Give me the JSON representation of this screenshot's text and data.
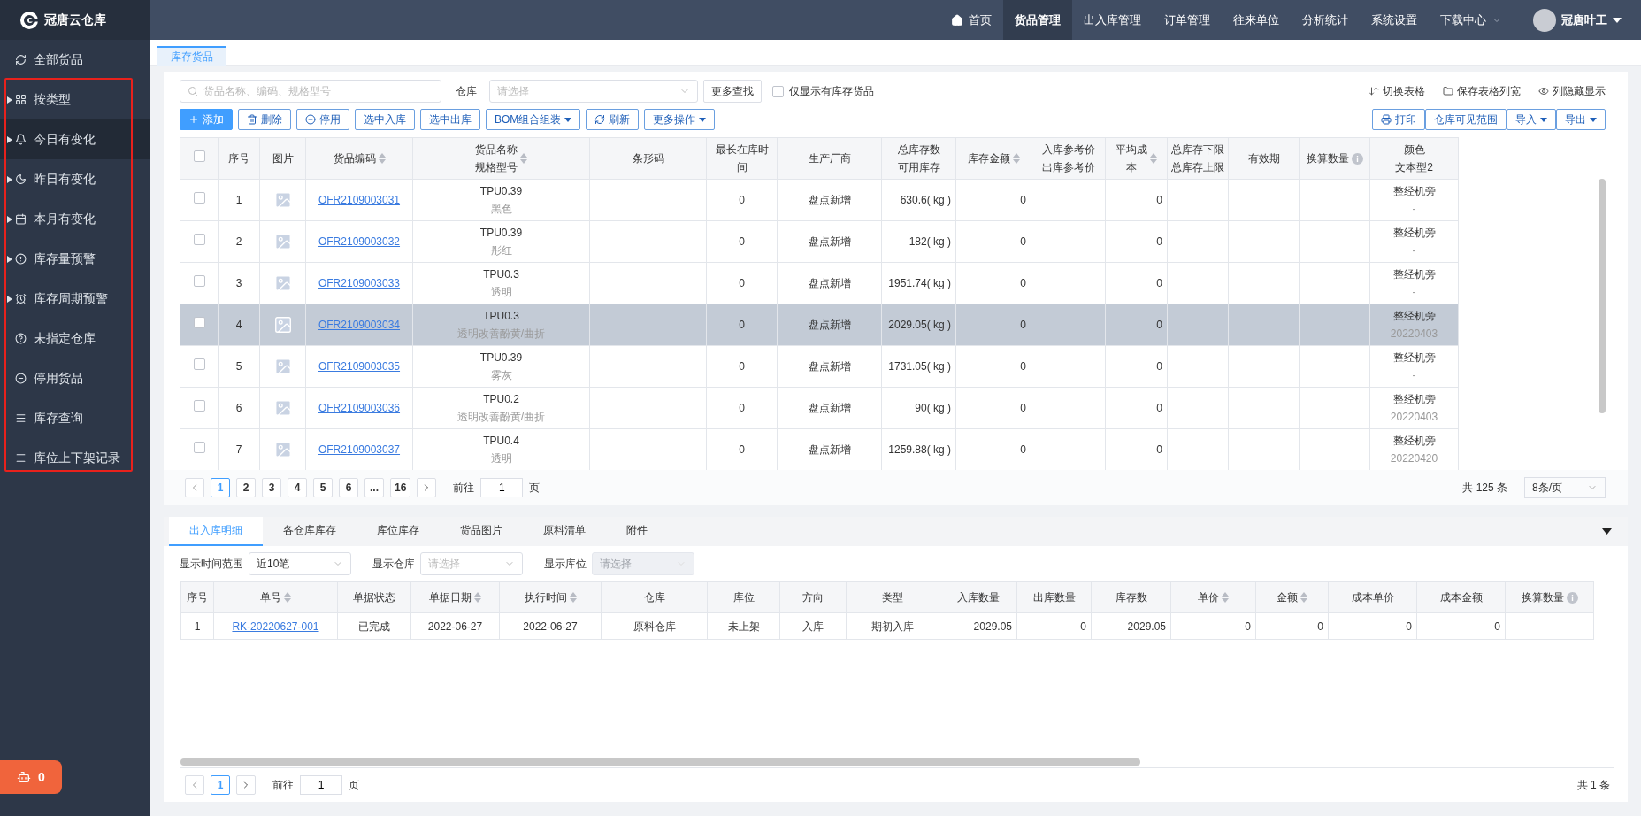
{
  "app": {
    "logo_text": "冠唐云仓库",
    "nav": [
      {
        "label": "首页",
        "kind": "home",
        "selected": false
      },
      {
        "label": "货品管理",
        "kind": "plain",
        "selected": true
      },
      {
        "label": "出入库管理",
        "kind": "plain",
        "selected": false
      },
      {
        "label": "订单管理",
        "kind": "plain",
        "selected": false
      },
      {
        "label": "往来单位",
        "kind": "plain",
        "selected": false
      },
      {
        "label": "分析统计",
        "kind": "plain",
        "selected": false
      },
      {
        "label": "系统设置",
        "kind": "plain",
        "selected": false
      },
      {
        "label": "下载中心",
        "kind": "dropdown",
        "selected": false
      }
    ],
    "user": {
      "name": "冠唐叶工"
    }
  },
  "sidebar": {
    "items": [
      {
        "label": "全部货品",
        "expandable": false,
        "selected": false
      },
      {
        "label": "按类型",
        "expandable": true,
        "selected": false
      },
      {
        "label": "今日有变化",
        "expandable": true,
        "selected": true
      },
      {
        "label": "昨日有变化",
        "expandable": true,
        "selected": false
      },
      {
        "label": "本月有变化",
        "expandable": true,
        "selected": false
      },
      {
        "label": "库存量预警",
        "expandable": true,
        "selected": false
      },
      {
        "label": "库存周期预警",
        "expandable": true,
        "selected": false
      },
      {
        "label": "未指定仓库",
        "expandable": false,
        "selected": false
      },
      {
        "label": "停用货品",
        "expandable": false,
        "selected": false
      },
      {
        "label": "库存查询",
        "expandable": false,
        "selected": false
      },
      {
        "label": "库位上下架记录",
        "expandable": false,
        "selected": false
      }
    ],
    "badge": {
      "count": "0"
    }
  },
  "page_tabs": [
    {
      "label": "库存货品",
      "selected": true
    }
  ],
  "filters": {
    "search": {
      "placeholder": "货品名称、编码、规格型号"
    },
    "warehouse": {
      "label": "仓库",
      "placeholder": "请选择"
    },
    "more_search": "更多查找",
    "only_stock": {
      "label": "仅显示有库存货品",
      "checked": false
    }
  },
  "view_links": [
    "切换表格",
    "保存表格列宽",
    "列隐藏显示"
  ],
  "actions": [
    {
      "label": "添加",
      "kind": "primary"
    },
    {
      "label": "删除",
      "kind": "plain"
    },
    {
      "label": "停用",
      "kind": "plain"
    },
    {
      "label": "选中入库",
      "kind": "plain"
    },
    {
      "label": "选中出库",
      "kind": "plain"
    },
    {
      "label": "BOM组合组装",
      "kind": "dropdown"
    },
    {
      "label": "刷新",
      "kind": "plain"
    },
    {
      "label": "更多操作",
      "kind": "dropdown"
    }
  ],
  "right_actions": [
    {
      "label": "打印",
      "kind": "plain"
    },
    {
      "label": "仓库可见范围",
      "kind": "plain"
    },
    {
      "label": "导入",
      "kind": "dropdown"
    },
    {
      "label": "导出",
      "kind": "dropdown"
    }
  ],
  "table": {
    "header_checkbox": {
      "checked": false
    },
    "columns": [
      {
        "lines": [
          "序号"
        ],
        "sortable": false,
        "info": false
      },
      {
        "lines": [
          "图片"
        ],
        "sortable": false,
        "info": false
      },
      {
        "lines": [
          "货品编码"
        ],
        "sortable": true,
        "info": false
      },
      {
        "lines": [
          "货品名称",
          "规格型号"
        ],
        "sortable": true,
        "info": false
      },
      {
        "lines": [
          "条形码"
        ],
        "sortable": false,
        "info": false
      },
      {
        "lines": [
          "最长在库时间"
        ],
        "sortable": false,
        "info": false
      },
      {
        "lines": [
          "生产厂商"
        ],
        "sortable": false,
        "info": false
      },
      {
        "lines": [
          "总库存数",
          "可用库存"
        ],
        "sortable": false,
        "info": false
      },
      {
        "lines": [
          "库存金额"
        ],
        "sortable": true,
        "info": false
      },
      {
        "lines": [
          "入库参考价",
          "出库参考价"
        ],
        "sortable": false,
        "info": false
      },
      {
        "lines": [
          "平均成",
          "本"
        ],
        "sortable": true,
        "info": false
      },
      {
        "lines": [
          "总库存下限",
          "总库存上限"
        ],
        "sortable": false,
        "info": false
      },
      {
        "lines": [
          "有效期"
        ],
        "sortable": false,
        "info": false
      },
      {
        "lines": [
          "换算数量"
        ],
        "sortable": false,
        "info": true
      },
      {
        "lines": [
          "颜色",
          "文本型2"
        ],
        "sortable": false,
        "info": false
      }
    ],
    "rows": [
      {
        "checked": false,
        "selected": false,
        "index": "1",
        "code": "OFR2109003031",
        "name": "TPU0.39",
        "spec": "黑色",
        "stock_time": "0",
        "maker": "盘点新增",
        "stock": "630.6( kg )",
        "amount": "0",
        "avg_cost": "0",
        "color_value": "整经机旁",
        "text2": "-"
      },
      {
        "checked": false,
        "selected": false,
        "index": "2",
        "code": "OFR2109003032",
        "name": "TPU0.39",
        "spec": "彤红",
        "stock_time": "0",
        "maker": "盘点新增",
        "stock": "182( kg )",
        "amount": "0",
        "avg_cost": "0",
        "color_value": "整经机旁",
        "text2": "-"
      },
      {
        "checked": false,
        "selected": false,
        "index": "3",
        "code": "OFR2109003033",
        "name": "TPU0.3",
        "spec": "透明",
        "stock_time": "0",
        "maker": "盘点新增",
        "stock": "1951.74( kg )",
        "amount": "0",
        "avg_cost": "0",
        "color_value": "整经机旁",
        "text2": "-"
      },
      {
        "checked": false,
        "selected": true,
        "index": "4",
        "code": "OFR2109003034",
        "name": "TPU0.3",
        "spec": "透明改善酚黄/曲折",
        "stock_time": "0",
        "maker": "盘点新增",
        "stock": "2029.05( kg )",
        "amount": "0",
        "avg_cost": "0",
        "color_value": "整经机旁",
        "text2": "20220403"
      },
      {
        "checked": false,
        "selected": false,
        "index": "5",
        "code": "OFR2109003035",
        "name": "TPU0.39",
        "spec": "雾灰",
        "stock_time": "0",
        "maker": "盘点新增",
        "stock": "1731.05( kg )",
        "amount": "0",
        "avg_cost": "0",
        "color_value": "整经机旁",
        "text2": "-"
      },
      {
        "checked": false,
        "selected": false,
        "index": "6",
        "code": "OFR2109003036",
        "name": "TPU0.2",
        "spec": "透明改善酚黄/曲折",
        "stock_time": "0",
        "maker": "盘点新增",
        "stock": "90( kg )",
        "amount": "0",
        "avg_cost": "0",
        "color_value": "整经机旁",
        "text2": "20220403"
      },
      {
        "checked": false,
        "selected": false,
        "index": "7",
        "code": "OFR2109003037",
        "name": "TPU0.4",
        "spec": "透明",
        "stock_time": "0",
        "maker": "盘点新增",
        "stock": "1259.88( kg )",
        "amount": "0",
        "avg_cost": "0",
        "color_value": "整经机旁",
        "text2": "20220420"
      }
    ]
  },
  "pagination": {
    "pages": [
      {
        "label": "1",
        "selected": true
      },
      {
        "label": "2",
        "selected": false
      },
      {
        "label": "3",
        "selected": false
      },
      {
        "label": "4",
        "selected": false
      },
      {
        "label": "5",
        "selected": false
      },
      {
        "label": "6",
        "selected": false
      },
      {
        "label": "...",
        "selected": false
      },
      {
        "label": "16",
        "selected": false
      }
    ],
    "goto_label": "前往",
    "goto_value": "1",
    "goto_suffix": "页",
    "total": "共 125 条",
    "page_size": "8条/页"
  },
  "detail": {
    "tabs": [
      {
        "label": "出入库明细",
        "selected": true
      },
      {
        "label": "各仓库库存",
        "selected": false
      },
      {
        "label": "库位库存",
        "selected": false
      },
      {
        "label": "货品图片",
        "selected": false
      },
      {
        "label": "原料清单",
        "selected": false
      },
      {
        "label": "附件",
        "selected": false
      }
    ],
    "filters": [
      {
        "label": "显示时间范围",
        "value": "近10笔",
        "disabled": false
      },
      {
        "label": "显示仓库",
        "placeholder": "请选择",
        "disabled": false
      },
      {
        "label": "显示库位",
        "placeholder": "请选择",
        "disabled": true
      }
    ],
    "columns": [
      {
        "label": "序号",
        "kind": "text",
        "sortable": false,
        "info": false
      },
      {
        "label": "单号",
        "kind": "link",
        "sortable": true,
        "info": false
      },
      {
        "label": "单据状态",
        "kind": "text",
        "sortable": false,
        "info": false
      },
      {
        "label": "单据日期",
        "kind": "text",
        "sortable": true,
        "info": false
      },
      {
        "label": "执行时间",
        "kind": "text",
        "sortable": true,
        "info": false
      },
      {
        "label": "仓库",
        "kind": "text",
        "sortable": false,
        "info": false
      },
      {
        "label": "库位",
        "kind": "text",
        "sortable": false,
        "info": false
      },
      {
        "label": "方向",
        "kind": "text",
        "sortable": false,
        "info": false
      },
      {
        "label": "类型",
        "kind": "text",
        "sortable": false,
        "info": false
      },
      {
        "label": "入库数量",
        "kind": "number",
        "sortable": false,
        "info": false
      },
      {
        "label": "出库数量",
        "kind": "number",
        "sortable": false,
        "info": false
      },
      {
        "label": "库存数",
        "kind": "number",
        "sortable": false,
        "info": false
      },
      {
        "label": "单价",
        "kind": "number",
        "sortable": true,
        "info": false
      },
      {
        "label": "金额",
        "kind": "number",
        "sortable": true,
        "info": false
      },
      {
        "label": "成本单价",
        "kind": "number",
        "sortable": false,
        "info": false
      },
      {
        "label": "成本金额",
        "kind": "number",
        "sortable": false,
        "info": false
      },
      {
        "label": "换算数量",
        "kind": "number",
        "sortable": false,
        "info": true
      }
    ],
    "rows": [
      {
        "cells": [
          "1",
          "RK-20220627-001",
          "已完成",
          "2022-06-27",
          "2022-06-27",
          "原料仓库",
          "未上架",
          "入库",
          "期初入库",
          "2029.05",
          "0",
          "2029.05",
          "0",
          "0",
          "0",
          "0"
        ]
      }
    ],
    "pagination": {
      "pages": [
        {
          "label": "1",
          "selected": true
        }
      ],
      "goto_label": "前往",
      "goto_value": "1",
      "goto_suffix": "页",
      "total": "共 1 条"
    }
  }
}
